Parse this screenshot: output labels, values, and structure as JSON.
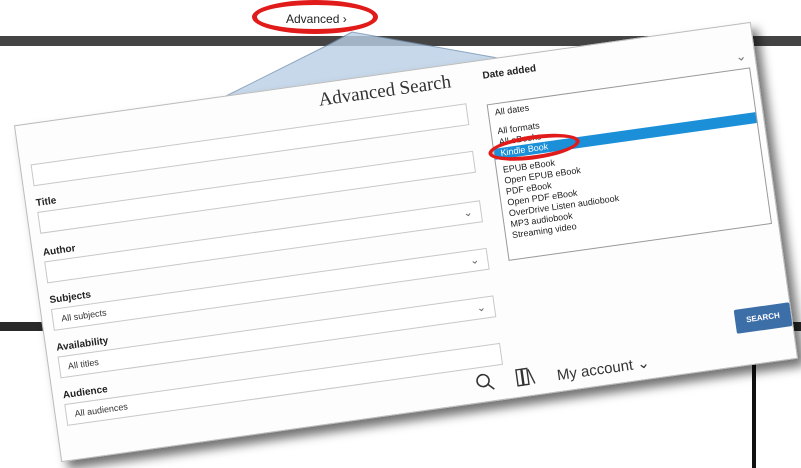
{
  "top_link": {
    "label": "Advanced ›"
  },
  "background": {
    "stub_text": "t"
  },
  "panel": {
    "title": "Advanced Search",
    "date_added_label": "Date added",
    "date_added_value": "All dates",
    "title_label": "Title",
    "author_label": "Author",
    "subjects_label": "Subjects",
    "subjects_value": "All subjects",
    "availability_label": "Availability",
    "availability_value": "All titles",
    "audience_label": "Audience",
    "audience_value": "All audiences",
    "search_button": "SEARCH",
    "format_options": [
      "All formats",
      "All eBooks",
      "Kindle Book",
      "EPUB eBook",
      "Open EPUB eBook",
      "PDF eBook",
      "Open PDF eBook",
      "OverDrive Listen audiobook",
      "MP3 audiobook",
      "Streaming video"
    ],
    "selected_format": "Kindle Book"
  },
  "footer": {
    "account_label": "My account ⌄",
    "search_icon": "search-icon",
    "library_icon": "books-icon"
  },
  "colors": {
    "highlight_red": "#e11a1a",
    "selection_blue": "#1b8fd8",
    "button_blue": "#3c6ea8"
  }
}
